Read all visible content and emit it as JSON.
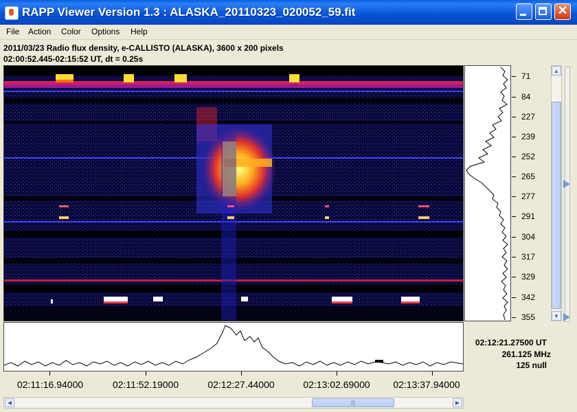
{
  "window": {
    "title": "RAPP Viewer Version 1.3 : ALASKA_20110323_020052_59.fit"
  },
  "menu": [
    "File",
    "Action",
    "Color",
    "Options",
    "Help"
  ],
  "info": {
    "line1": "2011/03/23  Radio flux density, e-CALLISTO (ALASKA),  3600 x 200 pixels",
    "line2": "02:00:52.445-02:15:52 UT,  dt = 0.25s"
  },
  "frequency_axis": {
    "labels": [
      "71",
      "84",
      "227",
      "239",
      "252",
      "265",
      "277",
      "291",
      "304",
      "317",
      "329",
      "342",
      "355"
    ]
  },
  "time_axis": {
    "labels": [
      "02:11:16.94000",
      "02:11:52.19000",
      "02:12:27.44000",
      "02:13:02.69000",
      "02:13:37.94000"
    ]
  },
  "cursor_readout": {
    "time": "02:12:21.27500 UT",
    "frequency": "261.125 MHz",
    "value": "125 null"
  },
  "colors": {
    "titlebar": "#0a55d8",
    "spectrogram_background": "#000000",
    "burst_core": "#ffff66",
    "noise": "#1a1aa0"
  },
  "icons": {
    "app": "java-cup-icon",
    "minimize": "minimize-icon",
    "maximize": "maximize-icon",
    "close": "close-icon"
  }
}
